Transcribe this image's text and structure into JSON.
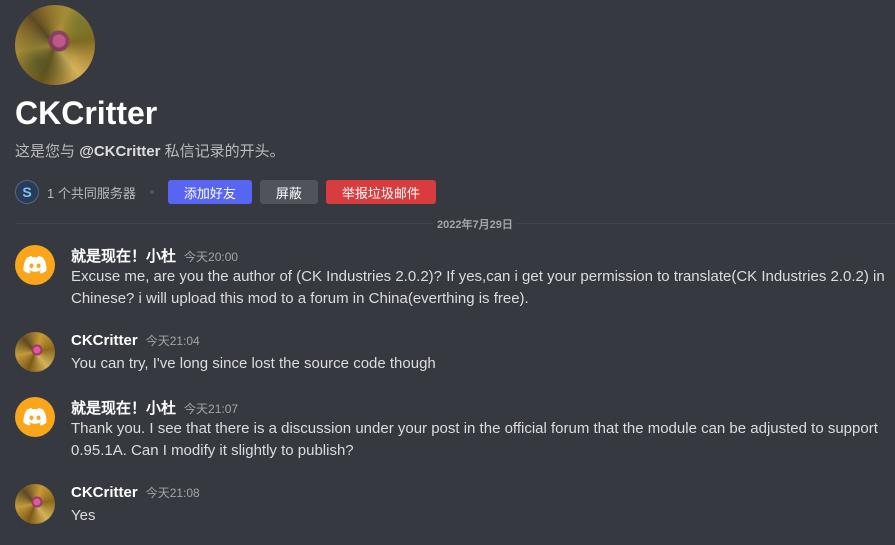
{
  "profile": {
    "name": "CKCritter",
    "intro_prefix": "这是您与",
    "intro_handle": "@CKCritter",
    "intro_suffix": "私信记录的开头。"
  },
  "actions": {
    "server_icon_letter": "S",
    "mutual_servers": "1 个共同服务器",
    "add_friend": "添加好友",
    "block": "屏蔽",
    "report_spam": "举报垃圾邮件"
  },
  "date_divider": "2022年7月29日",
  "colors": {
    "background": "#36393f",
    "primary": "#5865f2",
    "secondary": "#4f545c",
    "danger": "#d83c3e",
    "discord_avatar": "#faa61a"
  },
  "messages": [
    {
      "author": "就是现在！小杜",
      "time": "今天20:00",
      "avatar": "discord-icon",
      "text": "Excuse me, are you the author of (CK Industries 2.0.2)?   If yes,can i get your permission to translate(CK Industries 2.0.2) in Chinese?  i will upload this mod to a forum in China(everthing is free)."
    },
    {
      "author": "CKCritter",
      "time": "今天21:04",
      "avatar": "critter-avatar",
      "text": "You can try, I've long since lost the source code though"
    },
    {
      "author": "就是现在！小杜",
      "time": "今天21:07",
      "avatar": "discord-icon",
      "text": "Thank you. I see that there is a discussion under your post in the official forum that the module can be adjusted to support 0.95.1A. Can I modify it slightly to publish?"
    },
    {
      "author": "CKCritter",
      "time": "今天21:08",
      "avatar": "critter-avatar",
      "text": "Yes"
    }
  ]
}
